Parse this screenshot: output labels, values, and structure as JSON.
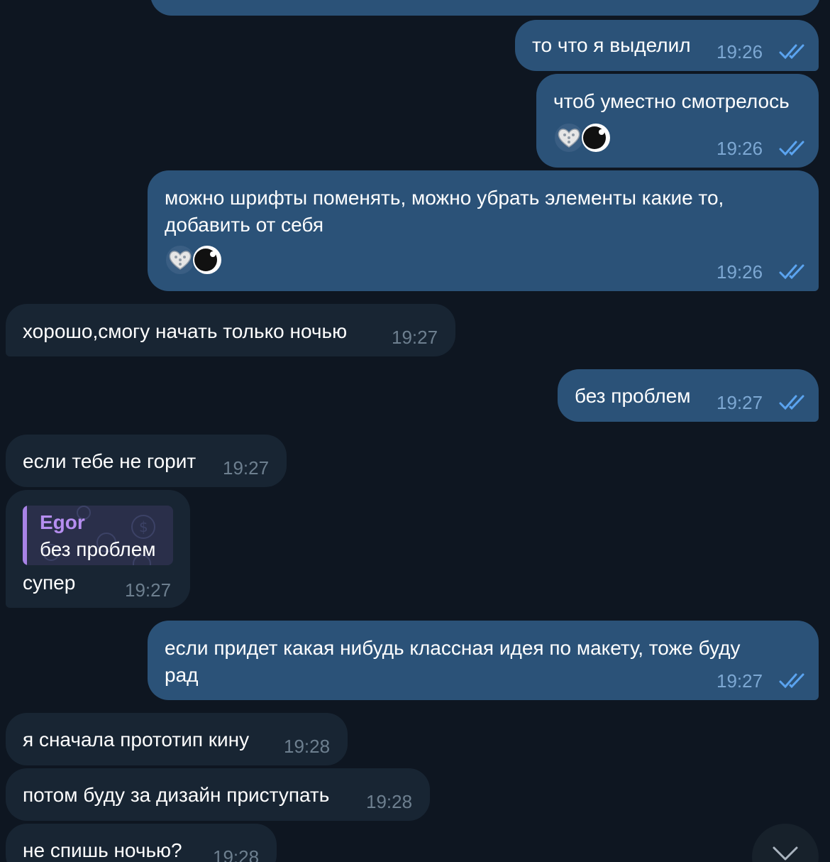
{
  "messages": [
    {
      "id": "m0",
      "direction": "out",
      "text": "",
      "time": ""
    },
    {
      "id": "m1",
      "direction": "out",
      "text": "то что я выделил",
      "time": "19:26",
      "status": "read"
    },
    {
      "id": "m2",
      "direction": "out",
      "text": "чтоб уместно смотрелось",
      "time": "19:26",
      "status": "read",
      "reactions": [
        "hearts-emoji",
        "avatar"
      ]
    },
    {
      "id": "m3",
      "direction": "out",
      "text": "можно шрифты поменять, можно убрать элементы какие то, добавить от себя",
      "time": "19:26",
      "status": "read",
      "reactions": [
        "hearts-emoji",
        "avatar"
      ]
    },
    {
      "id": "m4",
      "direction": "in",
      "text": "хорошо,смогу начать только ночью",
      "time": "19:27"
    },
    {
      "id": "m5",
      "direction": "out",
      "text": "без проблем",
      "time": "19:27",
      "status": "read"
    },
    {
      "id": "m6",
      "direction": "in",
      "text": "если тебе не горит",
      "time": "19:27"
    },
    {
      "id": "m7",
      "direction": "in",
      "text": "супер",
      "time": "19:27",
      "reply": {
        "name": "Egor",
        "text": "без проблем"
      }
    },
    {
      "id": "m8",
      "direction": "out",
      "text": "если придет какая нибудь классная идея по макету, тоже буду рад",
      "time": "19:27",
      "status": "read"
    },
    {
      "id": "m9",
      "direction": "in",
      "text": "я сначала прототип кину",
      "time": "19:28"
    },
    {
      "id": "m10",
      "direction": "in",
      "text": "потом буду за дизайн приступать",
      "time": "19:28"
    },
    {
      "id": "m11",
      "direction": "in",
      "text": "не спишь ночью?",
      "time": "19:28"
    }
  ],
  "scroll_down_button": {
    "icon": "chevron-down-icon"
  },
  "colors": {
    "background": "#0e1621",
    "outgoing_bubble": "#2b5278",
    "incoming_bubble": "#182533",
    "read_check": "#5ba4f0",
    "reply_name": "#b68ef0"
  }
}
